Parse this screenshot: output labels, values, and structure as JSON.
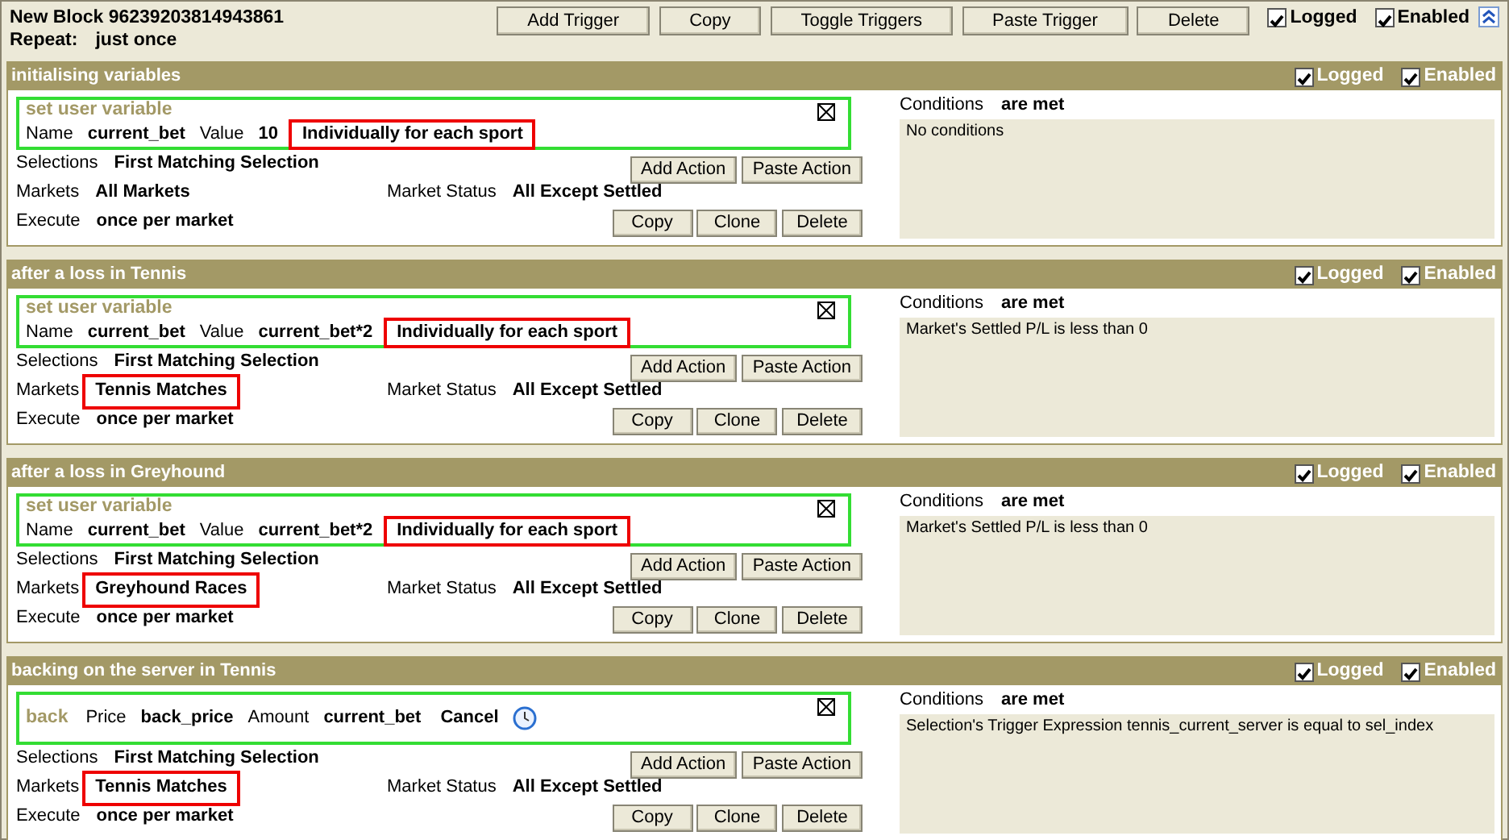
{
  "block": {
    "title": "New Block 96239203814943861",
    "repeat_label": "Repeat:",
    "repeat_value": "just once",
    "buttons": [
      "Add Trigger",
      "Copy",
      "Toggle Triggers",
      "Paste Trigger",
      "Delete"
    ],
    "logged": {
      "label": "Logged",
      "checked": true
    },
    "enabled": {
      "label": "Enabled",
      "checked": true
    }
  },
  "triggers": [
    {
      "title": "initialising variables",
      "logged": {
        "label": "Logged",
        "checked": true
      },
      "enabled": {
        "label": "Enabled",
        "checked": true
      },
      "action": {
        "title": "set user variable",
        "title_inline": false,
        "fields": [
          {
            "kind": "label",
            "text": "Name"
          },
          {
            "kind": "value",
            "text": "current_bet"
          },
          {
            "kind": "label",
            "text": "Value"
          },
          {
            "kind": "value",
            "text": "10"
          },
          {
            "kind": "value",
            "text": "Individually for each sport",
            "highlighted": true
          }
        ]
      },
      "selections": {
        "label": "Selections",
        "value": "First Matching Selection"
      },
      "markets": {
        "label": "Markets",
        "value": "All Markets",
        "highlighted": false
      },
      "market_status": {
        "label": "Market Status",
        "value": "All Except Settled"
      },
      "execute": {
        "label": "Execute",
        "value": "once per market"
      },
      "action_buttons": [
        "Add Action",
        "Paste Action"
      ],
      "trigger_buttons": [
        "Copy",
        "Clone",
        "Delete"
      ],
      "conditions": {
        "label": "Conditions",
        "value": "are met",
        "items": [
          "No conditions"
        ]
      }
    },
    {
      "title": "after a loss in Tennis",
      "logged": {
        "label": "Logged",
        "checked": true
      },
      "enabled": {
        "label": "Enabled",
        "checked": true
      },
      "action": {
        "title": "set user variable",
        "title_inline": false,
        "fields": [
          {
            "kind": "label",
            "text": "Name"
          },
          {
            "kind": "value",
            "text": "current_bet"
          },
          {
            "kind": "label",
            "text": "Value"
          },
          {
            "kind": "value",
            "text": "current_bet*2"
          },
          {
            "kind": "value",
            "text": "Individually for each sport",
            "highlighted": true
          }
        ]
      },
      "selections": {
        "label": "Selections",
        "value": "First Matching Selection"
      },
      "markets": {
        "label": "Markets",
        "value": "Tennis Matches",
        "highlighted": true
      },
      "market_status": {
        "label": "Market Status",
        "value": "All Except Settled"
      },
      "execute": {
        "label": "Execute",
        "value": "once per market"
      },
      "action_buttons": [
        "Add Action",
        "Paste Action"
      ],
      "trigger_buttons": [
        "Copy",
        "Clone",
        "Delete"
      ],
      "conditions": {
        "label": "Conditions",
        "value": "are met",
        "items": [
          "Market's Settled P/L is less than 0"
        ]
      }
    },
    {
      "title": "after a loss in Greyhound",
      "logged": {
        "label": "Logged",
        "checked": true
      },
      "enabled": {
        "label": "Enabled",
        "checked": true
      },
      "action": {
        "title": "set user variable",
        "title_inline": false,
        "fields": [
          {
            "kind": "label",
            "text": "Name"
          },
          {
            "kind": "value",
            "text": "current_bet"
          },
          {
            "kind": "label",
            "text": "Value"
          },
          {
            "kind": "value",
            "text": "current_bet*2"
          },
          {
            "kind": "value",
            "text": "Individually for each sport",
            "highlighted": true
          }
        ]
      },
      "selections": {
        "label": "Selections",
        "value": "First Matching Selection"
      },
      "markets": {
        "label": "Markets",
        "value": "Greyhound Races",
        "highlighted": true
      },
      "market_status": {
        "label": "Market Status",
        "value": "All Except Settled"
      },
      "execute": {
        "label": "Execute",
        "value": "once per market"
      },
      "action_buttons": [
        "Add Action",
        "Paste Action"
      ],
      "trigger_buttons": [
        "Copy",
        "Clone",
        "Delete"
      ],
      "conditions": {
        "label": "Conditions",
        "value": "are met",
        "items": [
          "Market's Settled P/L is less than 0"
        ]
      }
    },
    {
      "title": "backing on the server in Tennis",
      "logged": {
        "label": "Logged",
        "checked": true
      },
      "enabled": {
        "label": "Enabled",
        "checked": true
      },
      "action": {
        "title": "back",
        "title_inline": true,
        "fields": [
          {
            "kind": "label",
            "text": "Price"
          },
          {
            "kind": "value",
            "text": "back_price"
          },
          {
            "kind": "label",
            "text": "Amount"
          },
          {
            "kind": "value",
            "text": "current_bet"
          },
          {
            "kind": "value",
            "text": "Cancel"
          },
          {
            "kind": "timer"
          }
        ]
      },
      "selections": {
        "label": "Selections",
        "value": "First Matching Selection"
      },
      "markets": {
        "label": "Markets",
        "value": "Tennis Matches",
        "highlighted": true
      },
      "market_status": {
        "label": "Market Status",
        "value": "All Except Settled"
      },
      "execute": {
        "label": "Execute",
        "value": "once per market"
      },
      "action_buttons": [
        "Add Action",
        "Paste Action"
      ],
      "trigger_buttons": [
        "Copy",
        "Clone",
        "Delete"
      ],
      "conditions": {
        "label": "Conditions",
        "value": "are met",
        "items": [
          "Selection's Trigger Expression tennis_current_server is equal to sel_index"
        ]
      }
    }
  ]
}
